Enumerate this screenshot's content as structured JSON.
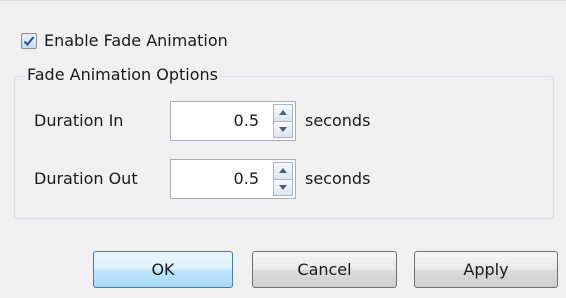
{
  "options": {
    "enable_label": "Enable Fade Animation",
    "enable_checked": true
  },
  "group": {
    "title": "Fade Animation Options",
    "duration_in": {
      "label": "Duration In",
      "value": "0.5",
      "unit": "seconds"
    },
    "duration_out": {
      "label": "Duration Out",
      "value": "0.5",
      "unit": "seconds"
    }
  },
  "buttons": {
    "ok": "OK",
    "cancel": "Cancel",
    "apply": "Apply"
  },
  "colors": {
    "dialog_background": "#f0f0f0",
    "default_button_border": "#3c7fb1",
    "check_mark": "#2b4e8c"
  },
  "icons": {
    "check": "check-mark-icon",
    "spin_up": "up-arrow-icon",
    "spin_down": "down-arrow-icon"
  }
}
